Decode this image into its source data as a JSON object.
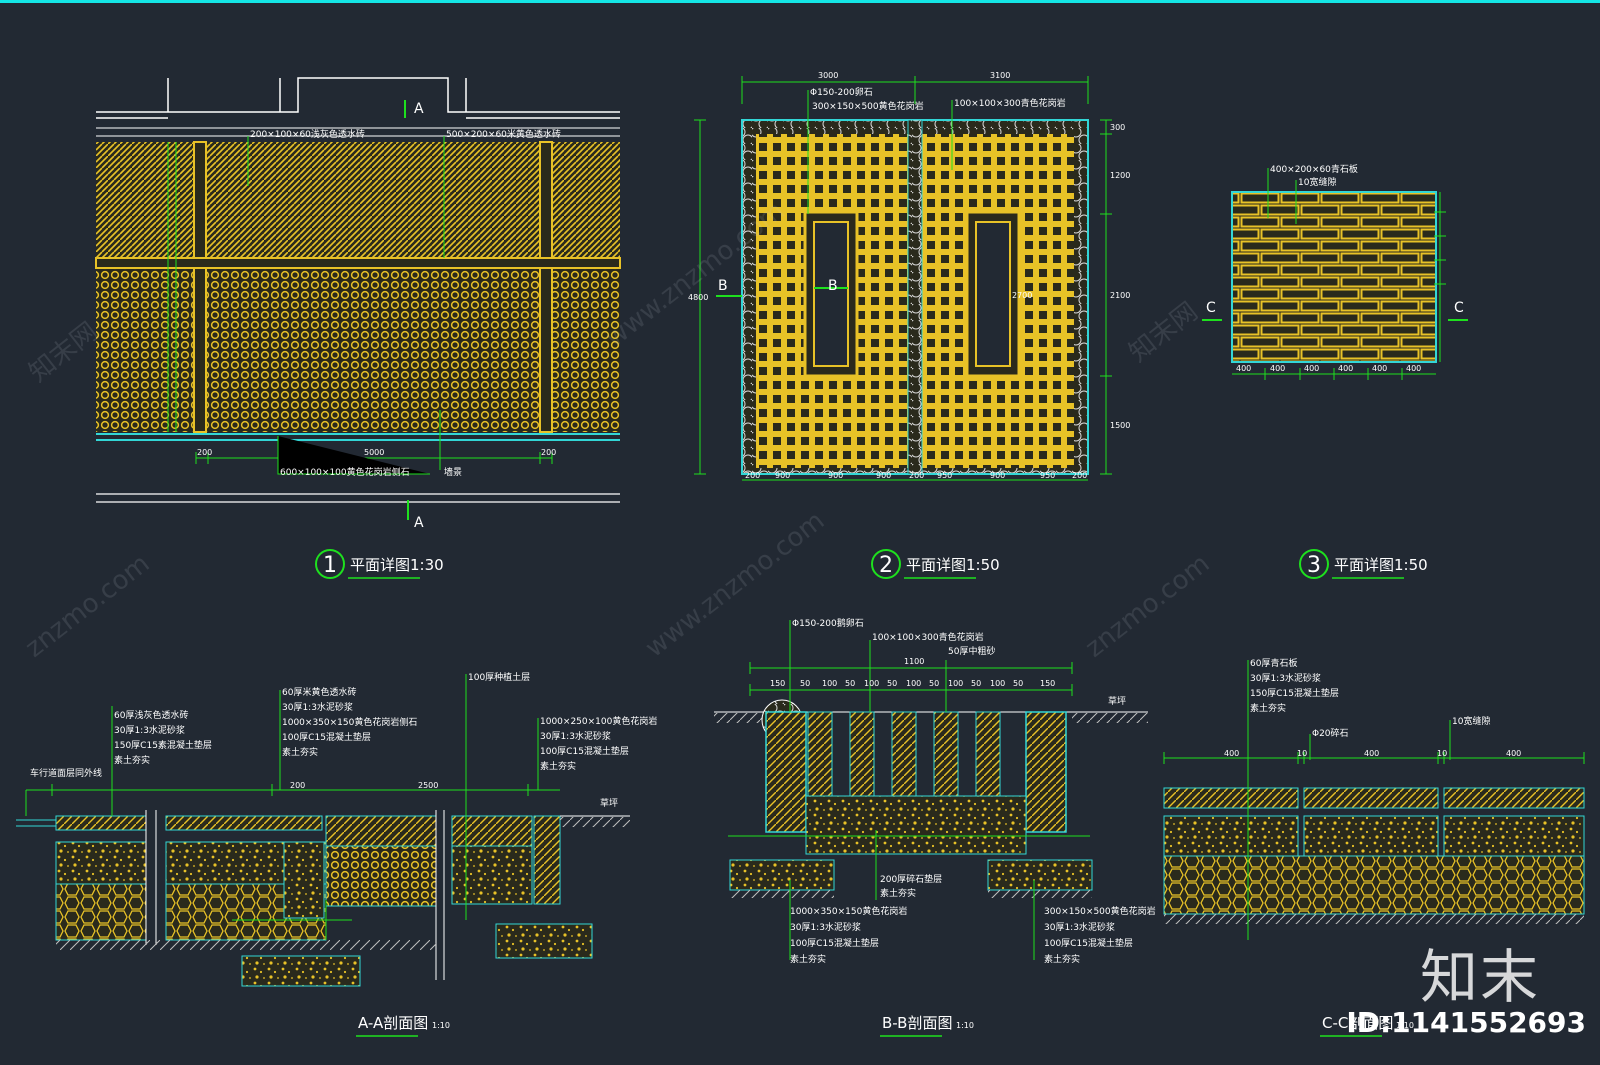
{
  "colors": {
    "background": "#222933",
    "top_border": "#14e6e6",
    "paving": "#e8c227",
    "outline_cyan": "#33d6d6",
    "dimension_green": "#1ee01e",
    "text": "#ffffff",
    "watermark": "#8a95a0"
  },
  "drawing1": {
    "circle_number": "1",
    "title": "平面详图1:30",
    "cut_mark_top": "A",
    "cut_mark_bottom": "A",
    "annotations": [
      "200×100×60浅灰色透水砖",
      "500×200×60米黄色透水砖",
      "600×100×100黄色花岗岩侧石",
      "墙景"
    ],
    "dimensions": [
      "200",
      "5000",
      "200"
    ]
  },
  "drawing2": {
    "circle_number": "2",
    "title": "平面详图1:50",
    "top_dims": [
      "3000",
      "3100"
    ],
    "cut_mark_left": "B",
    "cut_mark_inner": "B",
    "annotations": [
      "Φ150-200卵石",
      "300×150×500黄色花岗岩",
      "100×100×300青色花岗岩"
    ],
    "bottom_dims": [
      "200",
      "900",
      "900",
      "900",
      "200",
      "950",
      "900",
      "950",
      "200"
    ],
    "right_dims": [
      "300",
      "1200",
      "2100",
      "1500"
    ],
    "left_dim": "4800",
    "window_dim": "2700"
  },
  "drawing3": {
    "circle_number": "3",
    "title": "平面详图1:50",
    "cut_mark_left": "C",
    "cut_mark_right": "C",
    "annotations": [
      "400×200×60青石板",
      "10宽缝隙"
    ],
    "bottom_dims": [
      "400",
      "400",
      "400",
      "400",
      "400",
      "400"
    ]
  },
  "sectionA": {
    "title": "A-A剖面图",
    "scale": "1:10",
    "annotations": [
      "60厚浅灰色透水砖",
      "30厚1:3水泥砂浆",
      "150厚C15素混凝土垫层",
      "素土夯实",
      "60厚米黄色透水砖",
      "30厚1:3水泥砂浆",
      "1000×350×150黄色花岗岩侧石",
      "100厚C15混凝土垫层",
      "素土夯实",
      "100厚种植土层",
      "1000×250×100黄色花岗岩",
      "30厚1:3水泥砂浆",
      "100厚C15混凝土垫层",
      "素土夯实",
      "车行道面层同外线",
      "草坪"
    ],
    "dims": [
      "200",
      "2500"
    ]
  },
  "sectionB": {
    "title": "B-B剖面图",
    "scale": "1:10",
    "annotations": [
      "Φ150-200鹅卵石",
      "100×100×300青色花岗岩",
      "50厚中粗砂",
      "草坪",
      "200厚碎石垫层",
      "素土夯实",
      "1000×350×150黄色花岗岩",
      "30厚1:3水泥砂浆",
      "100厚C15混凝土垫层",
      "素土夯实",
      "300×150×500黄色花岗岩",
      "30厚1:3水泥砂浆",
      "100厚C15混凝土垫层",
      "素土夯实"
    ],
    "top_dims": [
      "150",
      "50",
      "100",
      "50",
      "100",
      "50",
      "100",
      "50",
      "100",
      "50",
      "100",
      "50",
      "150"
    ],
    "overall_dim": "1100"
  },
  "sectionC": {
    "title": "C-C剖面图",
    "scale": "1:10",
    "annotations": [
      "60厚青石板",
      "30厚1:3水泥砂浆",
      "150厚C15混凝土垫层",
      "素土夯实",
      "Φ20碎石",
      "10宽缝隙"
    ],
    "dims": [
      "400",
      "10",
      "400",
      "10",
      "400"
    ]
  },
  "watermarks": [
    "znzmo.com",
    "www.znzmo.com",
    "知末网"
  ],
  "brand_mark": "知末",
  "id_text": "ID:1141552693"
}
